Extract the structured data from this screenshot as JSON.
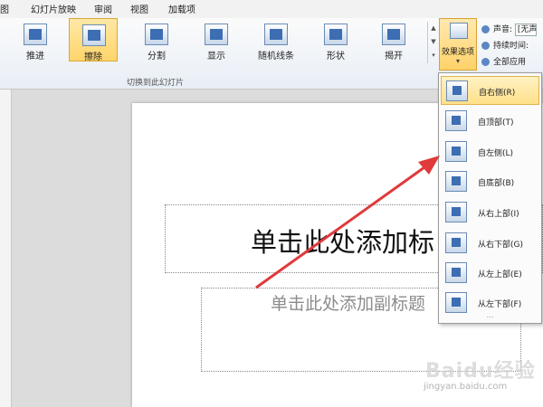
{
  "menubar": {
    "items": [
      "图",
      "幻灯片放映",
      "审阅",
      "视图",
      "加载项"
    ]
  },
  "ribbon": {
    "transitions": [
      {
        "label": "推进",
        "icon": "push-transition-icon"
      },
      {
        "label": "擦除",
        "icon": "wipe-transition-icon",
        "selected": true
      },
      {
        "label": "分割",
        "icon": "split-transition-icon"
      },
      {
        "label": "显示",
        "icon": "reveal-transition-icon"
      },
      {
        "label": "随机线条",
        "icon": "random-bars-transition-icon"
      },
      {
        "label": "形状",
        "icon": "shape-transition-icon"
      },
      {
        "label": "揭开",
        "icon": "uncover-transition-icon"
      }
    ],
    "group_label": "切换到此幻灯片",
    "effect_options_label": "效果选项",
    "sound_label": "声音:",
    "sound_value": "[无声",
    "duration_label": "持续时间:",
    "apply_all_label": "全部应用"
  },
  "slide": {
    "title_placeholder": "单击此处添加标",
    "subtitle_placeholder": "单击此处添加副标题"
  },
  "effect_menu": {
    "items": [
      {
        "label": "自右侧(R)",
        "icon": "from-right-icon",
        "selected": true
      },
      {
        "label": "自顶部(T)",
        "icon": "from-top-icon"
      },
      {
        "label": "自左侧(L)",
        "icon": "from-left-icon"
      },
      {
        "label": "自底部(B)",
        "icon": "from-bottom-icon"
      },
      {
        "label": "从右上部(I)",
        "icon": "from-top-right-icon"
      },
      {
        "label": "从右下部(G)",
        "icon": "from-bottom-right-icon"
      },
      {
        "label": "从左上部(E)",
        "icon": "from-top-left-icon"
      },
      {
        "label": "从左下部(F)",
        "icon": "from-bottom-left-icon"
      }
    ]
  },
  "watermark": {
    "text": "Baidu经验",
    "url": "jingyan.baidu.com"
  },
  "colors": {
    "accent": "#ffd56b",
    "annotation_arrow": "#e03a3a"
  }
}
